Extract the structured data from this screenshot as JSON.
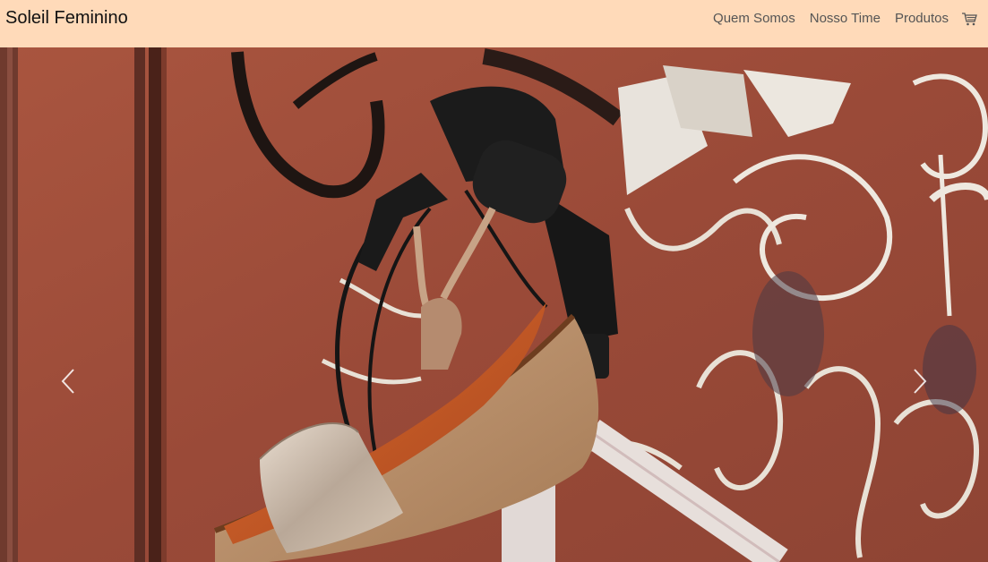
{
  "navbar": {
    "brand": "Soleil Feminino",
    "links": [
      "Quem Somos",
      "Nosso Time",
      "Produtos"
    ],
    "cart_icon": "shopping-cart-icon",
    "background": "#ffdab9"
  },
  "carousel": {
    "prev_icon": "chevron-left-icon",
    "next_icon": "chevron-right-icon",
    "slide_image": "wedge-sandal-hanging-on-bicycle-handlebar"
  }
}
